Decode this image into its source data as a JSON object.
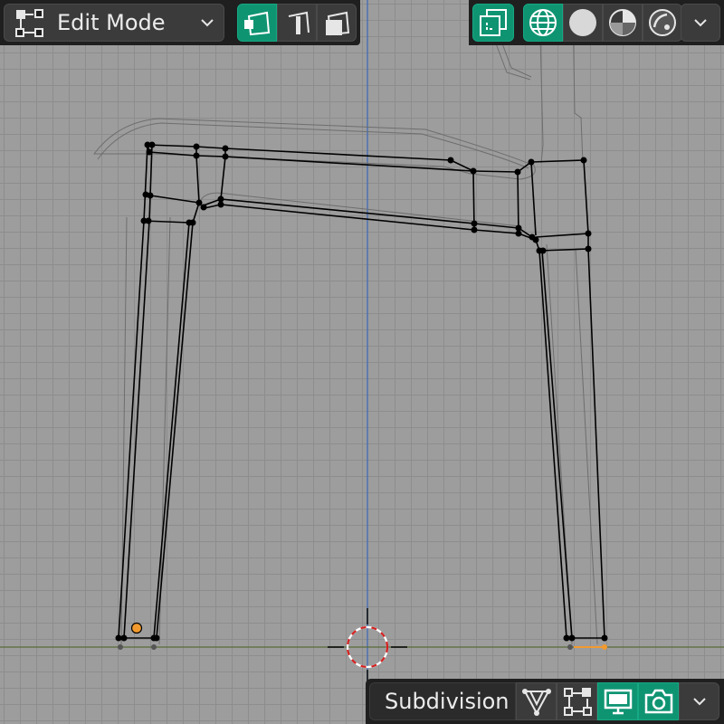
{
  "header": {
    "mode_label": "Edit Mode",
    "mode_icon": "edit-mode-icon",
    "select_modes": [
      {
        "name": "vertex-select",
        "active": true
      },
      {
        "name": "edge-select",
        "active": false
      },
      {
        "name": "face-select",
        "active": false
      }
    ]
  },
  "viewport_shading": {
    "overlay_active": true,
    "modes": [
      {
        "name": "wireframe",
        "active": true
      },
      {
        "name": "solid",
        "active": false
      },
      {
        "name": "material-preview",
        "active": false
      },
      {
        "name": "rendered",
        "active": false
      }
    ]
  },
  "modifier": {
    "name": "Subdivision",
    "buttons": [
      {
        "name": "on-cage",
        "active": false
      },
      {
        "name": "edit-mode",
        "active": false
      },
      {
        "name": "realtime",
        "active": true
      },
      {
        "name": "render",
        "active": true
      }
    ]
  },
  "colors": {
    "accent": "#0f9472",
    "viewport_bg": "#9d9d9d",
    "grid": "#8d8d8d",
    "edge": "#000000",
    "selected_vertex": "#f29a2e",
    "z_axis": "#3f6bb5",
    "x_axis": "#5a6b3a"
  }
}
